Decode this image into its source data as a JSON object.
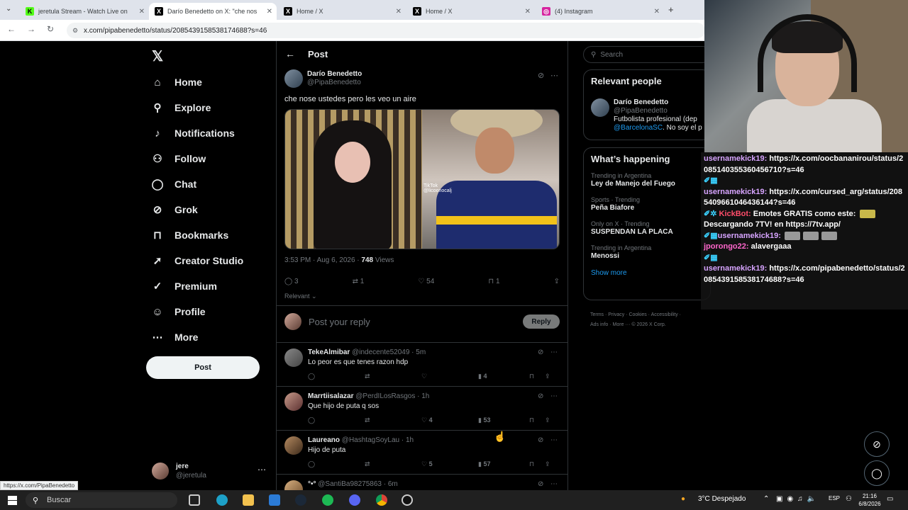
{
  "browser": {
    "tabs": [
      {
        "title": "jeretula Stream - Watch Live on",
        "favicon": "kick-icon",
        "color": "#53fc18"
      },
      {
        "title": "Darío Benedetto on X: \"che nos",
        "favicon": "x-icon",
        "color": "#000000"
      },
      {
        "title": "Home / X",
        "favicon": "x-icon",
        "color": "#000000"
      },
      {
        "title": "Home / X",
        "favicon": "x-icon",
        "color": "#000000"
      },
      {
        "title": "(4) Instagram",
        "favicon": "instagram-icon",
        "color": "#d6249f"
      }
    ],
    "url": "x.com/pipabenedetto/status/2085439158538174688?s=46",
    "status_url": "https://x.com/PipaBenedetto"
  },
  "nav": {
    "items": [
      {
        "label": "Home",
        "icon": "⌂"
      },
      {
        "label": "Explore",
        "icon": "⚲"
      },
      {
        "label": "Notifications",
        "icon": "🔔"
      },
      {
        "label": "Follow",
        "icon": "👤"
      },
      {
        "label": "Chat",
        "icon": "◯"
      },
      {
        "label": "Grok",
        "icon": "⊘"
      },
      {
        "label": "Bookmarks",
        "icon": "⊓"
      },
      {
        "label": "Creator Studio",
        "icon": "➚"
      },
      {
        "label": "Premium",
        "icon": "✓"
      },
      {
        "label": "Profile",
        "icon": "👤"
      },
      {
        "label": "More",
        "icon": "⋯"
      }
    ],
    "post_button": "Post",
    "account": {
      "name": "jere",
      "handle": "@jeretula"
    }
  },
  "post": {
    "header": "Post",
    "author_name": "Darío Benedetto",
    "author_handle": "@PipaBenedetto",
    "text": "che nose ustedes pero les veo un aire",
    "watermark": "TikTok\n@licoonocalj",
    "time": "3:53 PM · Aug 6, 2026 · ",
    "views": "748",
    "views_label": " Views",
    "replies": "3",
    "reposts": "1",
    "likes": "54",
    "bookmarks": "1",
    "sort": "Relevant",
    "reply_placeholder": "Post your reply",
    "reply_button": "Reply"
  },
  "replies": [
    {
      "name": "TekeAlmibar",
      "meta": " @indecente52049 · 5m",
      "text": "Lo peor es que tenes razon hdp",
      "likes": "",
      "views": "4"
    },
    {
      "name": "Marrtiisalazar",
      "meta": " @PerdILosRasgos · 1h",
      "text": "Que hijo de puta q sos",
      "likes": "4",
      "views": "53"
    },
    {
      "name": "Laureano",
      "meta": " @HashtagSoyLau · 1h",
      "text": "Hijo de puta",
      "likes": "5",
      "views": "57"
    },
    {
      "name": "°•°",
      "meta": " @SantiBa98275863 · 6m",
      "text": "",
      "likes": "",
      "views": ""
    }
  ],
  "sidebar": {
    "search_placeholder": "Search",
    "relevant_title": "Relevant people",
    "person_name": "Darío Benedetto",
    "person_handle": "@PipaBenedetto",
    "person_bio1": "Futbolista profesional (dep",
    "person_bio2_link": "@BarcelonaSC",
    "person_bio2": ". No soy el p",
    "happening_title": "What’s happening",
    "trends": [
      {
        "context": "Trending in Argentina",
        "name": "Ley de Manejo del Fuego"
      },
      {
        "context": "Sports · Trending",
        "name": "Peña Biafore"
      },
      {
        "context": "Only on X · Trending",
        "name": "SUSPENDAN LA PLACA"
      },
      {
        "context": "Trending in Argentina",
        "name": "Menossi"
      }
    ],
    "show_more": "Show more",
    "footer1": "Terms · Privacy · Cookies · Accessibility ·",
    "footer2": "Ads info · More ··· © 2026 X Corp."
  },
  "chat": [
    {
      "user": "usernamekick19:",
      "text": " https://x.com/oocbananirou/status/2085140355360456710?s=46",
      "badge": ""
    },
    {
      "user": "",
      "text": "",
      "badge": "✐▦"
    },
    {
      "user": "usernamekick19:",
      "text": " https://x.com/cursed_arg/status/2085409661046436144?s=46",
      "badge": ""
    },
    {
      "user": "KickBot:",
      "text": " Emotes GRATIS como este: ",
      "text2": "Descargando 7TV! en https://7tv.app/",
      "badge": "✐✲"
    },
    {
      "user": "usernamekick19:",
      "text": "",
      "badge": "✐▦"
    },
    {
      "user": "jporongo22:",
      "text": " alavergaaa",
      "badge": ""
    },
    {
      "user": "",
      "text": "",
      "badge": "✐▦"
    },
    {
      "user": "usernamekick19:",
      "text": " https://x.com/pipabenedetto/status/2085439158538174688?s=46",
      "badge": ""
    }
  ],
  "taskbar": {
    "search": "Buscar",
    "temp": "3°C",
    "weather": "Despejado",
    "lang": "ESP",
    "time": "21:16",
    "date": "6/8/2026"
  }
}
